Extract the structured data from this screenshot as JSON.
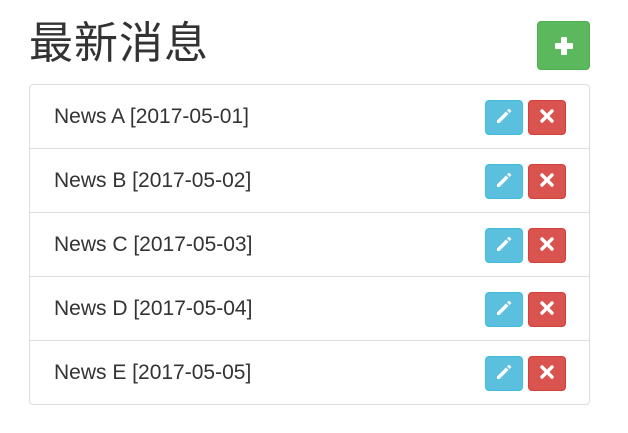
{
  "header": {
    "title": "最新消息",
    "add_icon": "plus-icon"
  },
  "colors": {
    "add_button": "#5cb85c",
    "edit_button": "#5bc0de",
    "delete_button": "#d9534f",
    "border": "#dddddd",
    "text": "#333333"
  },
  "icons": {
    "edit": "pencil-icon",
    "delete": "close-icon"
  },
  "news": [
    {
      "label": "News A [2017-05-01]"
    },
    {
      "label": "News B [2017-05-02]"
    },
    {
      "label": "News C [2017-05-03]"
    },
    {
      "label": "News D [2017-05-04]"
    },
    {
      "label": "News E [2017-05-05]"
    }
  ]
}
